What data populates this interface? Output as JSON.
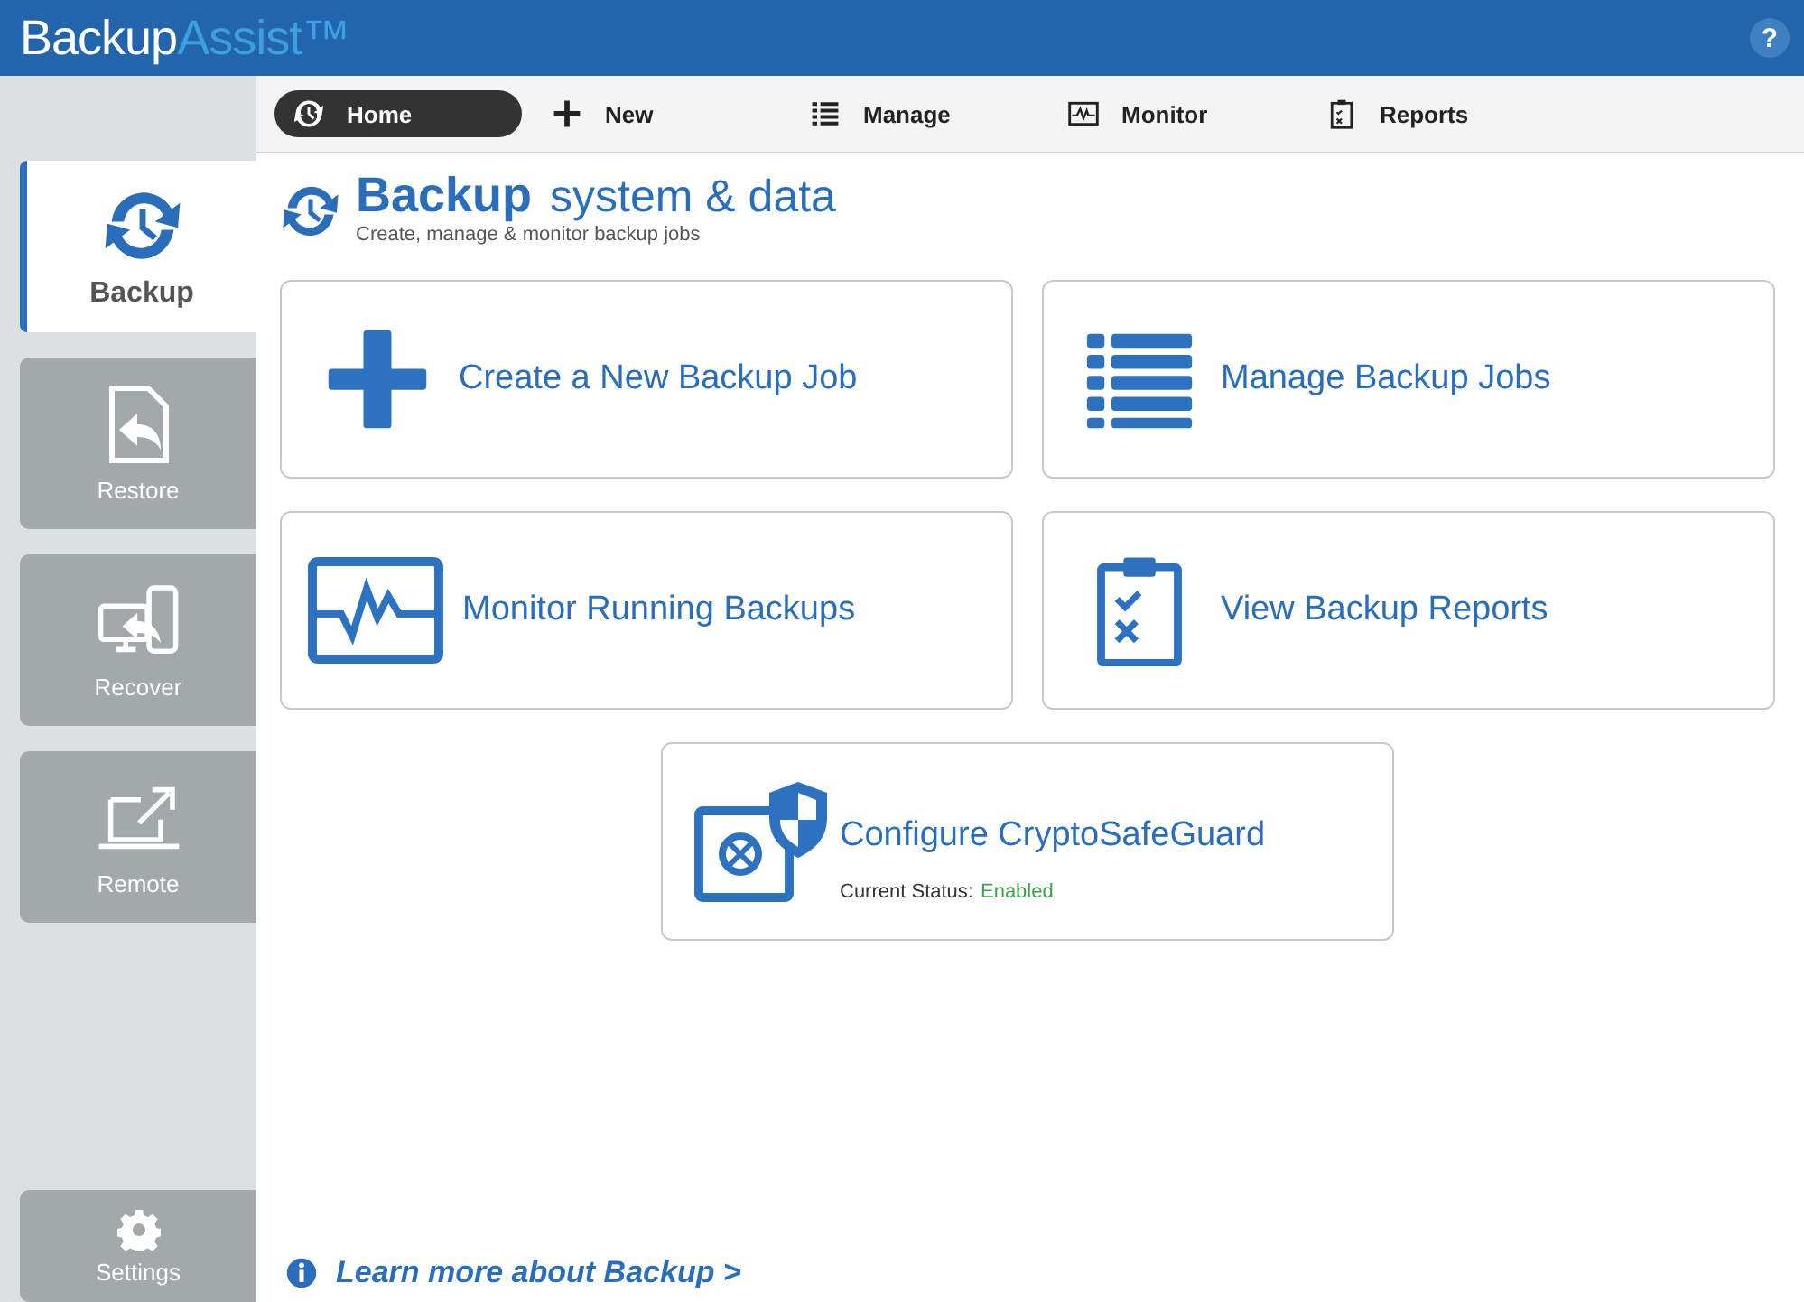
{
  "header": {
    "logo_first": "Backup",
    "logo_second": "Assist™",
    "help": "?"
  },
  "sidebar": {
    "items": [
      {
        "label": "Backup",
        "selected": true
      },
      {
        "label": "Restore",
        "selected": false
      },
      {
        "label": "Recover",
        "selected": false
      },
      {
        "label": "Remote",
        "selected": false
      }
    ],
    "settings": {
      "label": "Settings",
      "selected": false
    }
  },
  "toolbar": {
    "tabs": [
      {
        "label": "Home",
        "selected": true
      },
      {
        "label": "New",
        "selected": false
      },
      {
        "label": "Manage",
        "selected": false
      },
      {
        "label": "Monitor",
        "selected": false
      },
      {
        "label": "Reports",
        "selected": false
      }
    ]
  },
  "page": {
    "title_bold": "Backup",
    "title_rest": "system & data",
    "subtitle": "Create, manage & monitor backup jobs"
  },
  "cards": [
    {
      "label": "Create a New Backup Job"
    },
    {
      "label": "Manage Backup Jobs"
    },
    {
      "label": "Monitor Running Backups"
    },
    {
      "label": "View Backup Reports"
    }
  ],
  "crypto_card": {
    "label": "Configure CryptoSafeGuard",
    "status_label": "Current Status:",
    "status_value": "Enabled",
    "enabled": true
  },
  "learn_more": "Learn more about Backup >"
}
